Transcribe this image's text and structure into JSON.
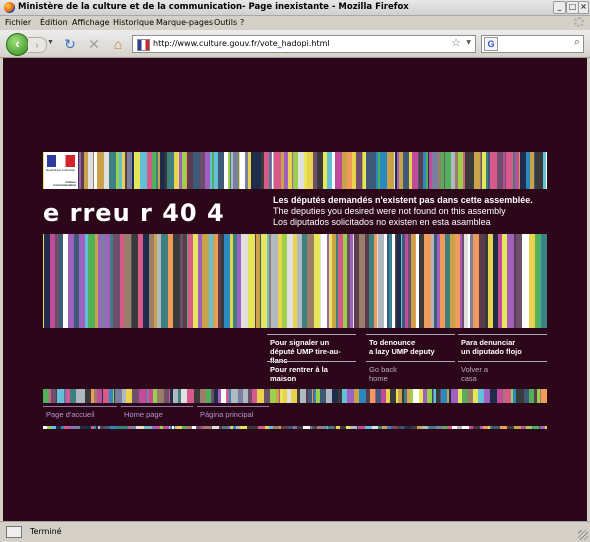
{
  "window": {
    "title": "Ministère de la culture et de la communication- Page inexistante - Mozilla Firefox"
  },
  "menu": {
    "items": [
      "Fichier",
      "Édition",
      "Affichage",
      "Historique",
      "Marque-pages",
      "Outils",
      "?"
    ]
  },
  "navbar": {
    "url": "http://www.culture.gouv.fr/vote_hadopi.html",
    "search_placeholder": ""
  },
  "page": {
    "background": "#2c0619",
    "glitch_title": "e  rreu  r  40 4",
    "logo_text": {
      "top": "République Française",
      "bottom": "Culture Communication"
    },
    "message": {
      "fr": "Les députés demandés n'existent pas dans cette assemblée.",
      "en": "The deputies you desired were not found on this assembly",
      "es": "Los diputados solicitados no existen en esta asamblea"
    },
    "actions": {
      "denounce_fr": "Pour signaler un\ndéputé UMP tire-au-flanc",
      "denounce_en": "To denounce\na lazy UMP deputy",
      "denounce_es": "Para denunciar\nun diputado flojo",
      "back_fr": "Pour rentrer à la\nmaison",
      "back_en": "Go back\nhome",
      "back_es": "Volver a\ncasa"
    },
    "footer_links": [
      "Page d'accueil",
      "Home page",
      "Página principal"
    ]
  },
  "status": {
    "text": "Terminé"
  },
  "stripe_palette": [
    "#ffffff",
    "#7a7fa0",
    "#3e5a78",
    "#9a7e6a",
    "#5a3c4c",
    "#b0b8c0",
    "#3c8080",
    "#c9a24a",
    "#e8d24e",
    "#9bd04a",
    "#2a8ac0",
    "#c04b9a",
    "#d85a8a",
    "#e0e0e0",
    "#6d4f6b",
    "#1f2c4c",
    "#f29a5a",
    "#64c0d8",
    "#a060c0",
    "#3a3a3a",
    "#e6e65a",
    "#52b05a"
  ]
}
